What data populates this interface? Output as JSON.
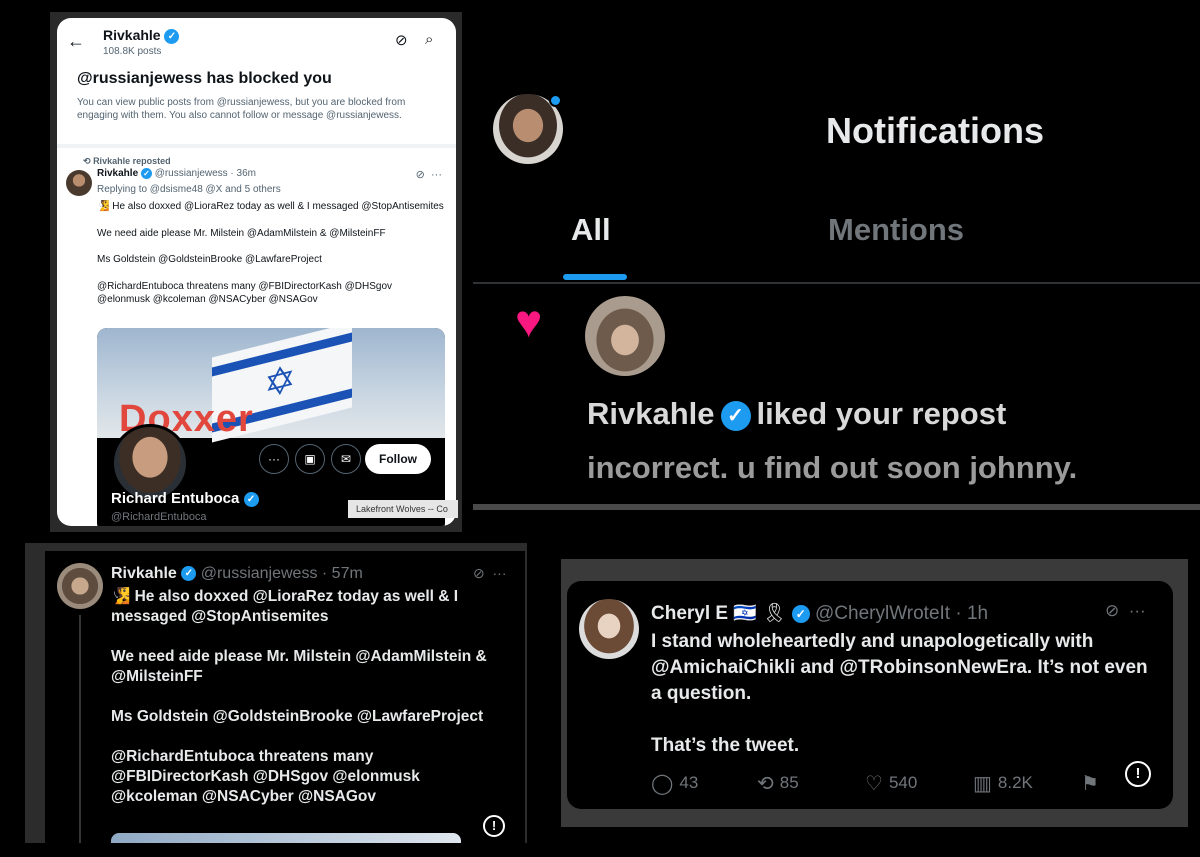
{
  "panel1": {
    "profile_name": "Rivkahle",
    "post_count": "108.8K posts",
    "blocked_title": "@russianjewess has blocked you",
    "blocked_body": "You can view public posts from @russianjewess, but you are blocked from engaging with them. You also cannot follow or message @russianjewess.",
    "repost_label": "Rivkahle reposted",
    "tweet_name": "Rivkahle",
    "tweet_handle_time": "@russianjewess · 36m",
    "replying_to": "Replying to @dsisme48 @X and 5 others",
    "lines": [
      "🧏 He also doxxed @LioraRez today as well & I messaged @StopAntisemites",
      "We need aide please Mr. Milstein @AdamMilstein & @MilsteinFF",
      "Ms Goldstein @GoldsteinBrooke @LawfareProject",
      "@RichardEntuboca threatens many @FBIDirectorKash @DHSgov @elonmusk @kcoleman @NSACyber @NSAGov"
    ],
    "card": {
      "overlay_text": "Doxxer",
      "follow_label": "Follow",
      "name": "Richard Entuboca",
      "handle": "@RichardEntuboca"
    },
    "overlay_tag": "Lakefront Wolves -- Co"
  },
  "panel2": {
    "title": "Notifications",
    "tab_all": "All",
    "tab_mentions": "Mentions",
    "liked_name": "Rivkahle",
    "liked_text": "liked your repost",
    "quote": "incorrect. u find out soon johnny."
  },
  "panel3": {
    "name": "Rivkahle",
    "handle_time": "@russianjewess · 57m",
    "lines": [
      "🧏 He also doxxed @LioraRez today as well & I messaged @StopAntisemites",
      "We need aide please Mr. Milstein @AdamMilstein & @MilsteinFF",
      "Ms Goldstein @GoldsteinBrooke @LawfareProject",
      "@RichardEntuboca threatens many @FBIDirectorKash @DHSgov @elonmusk @kcoleman @NSACyber @NSAGov"
    ]
  },
  "panel4": {
    "name": "Cheryl E",
    "flags": "🇮🇱 🎗",
    "handle_time": "@CherylWroteIt · 1h",
    "line1": "I stand wholeheartedly and unapologetically with @AmichaiChikli and @TRobinsonNewEra. It’s not even a question.",
    "line2": "That’s the tweet.",
    "replies": "43",
    "reposts": "85",
    "likes": "540",
    "views": "8.2K"
  },
  "colors": {
    "accent": "#1d9bf0",
    "like": "#f91880"
  }
}
